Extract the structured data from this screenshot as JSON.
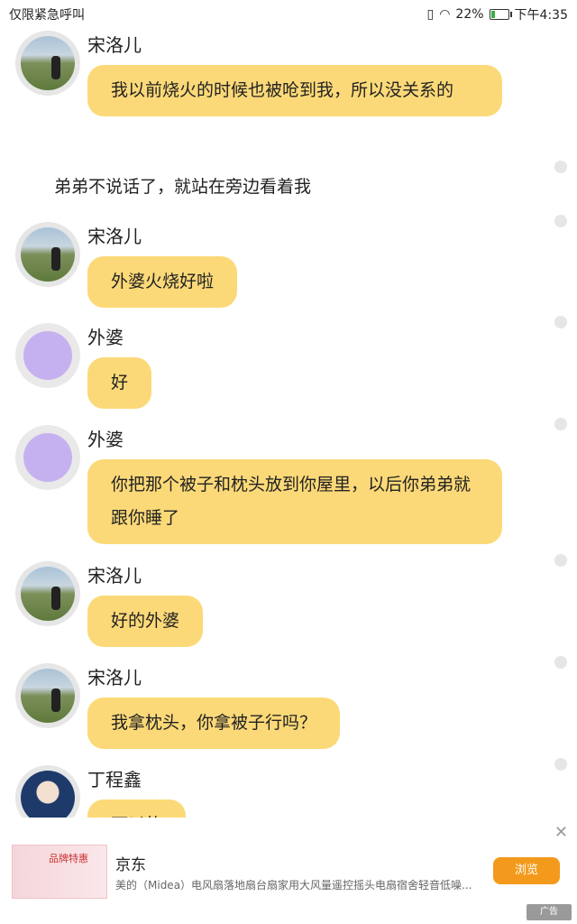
{
  "status_bar": {
    "left_text": "仅限紧急呼叫",
    "battery": "22%",
    "time": "下午4:35"
  },
  "messages": [
    {
      "type": "msg",
      "sender": "宋洛儿",
      "avatar": "photo",
      "text": "￼￼我以前烧火的时候也被呛到我，所以没关系的"
    },
    {
      "type": "narration",
      "text": "弟弟不说话了，就站在旁边看着我"
    },
    {
      "type": "msg",
      "sender": "宋洛儿",
      "avatar": "photo",
      "text": "外婆火烧好啦"
    },
    {
      "type": "msg",
      "sender": "外婆",
      "avatar": "ghost",
      "text": "好"
    },
    {
      "type": "msg",
      "sender": "外婆",
      "avatar": "ghost",
      "text": "你把那个被子和枕头放到你屋里，以后你弟弟就跟你睡了"
    },
    {
      "type": "msg",
      "sender": "宋洛儿",
      "avatar": "photo",
      "text": "好的外婆"
    },
    {
      "type": "msg",
      "sender": "宋洛儿",
      "avatar": "photo",
      "text": "我拿枕头，你拿被子行吗？"
    },
    {
      "type": "msg",
      "sender": "丁程鑫",
      "avatar": "person",
      "text": "可以的"
    }
  ],
  "ad": {
    "close_icon": "close-icon",
    "thumb_text": "品牌特惠",
    "title": "京东",
    "description": "美的（Midea）电风扇落地扇台扇家用大风量遥控摇头电扇宿舍轻音低噪...",
    "button": "浏览",
    "badge": "广告"
  },
  "colors": {
    "bubble": "#fcd978",
    "ad_button": "#f39a1c"
  }
}
